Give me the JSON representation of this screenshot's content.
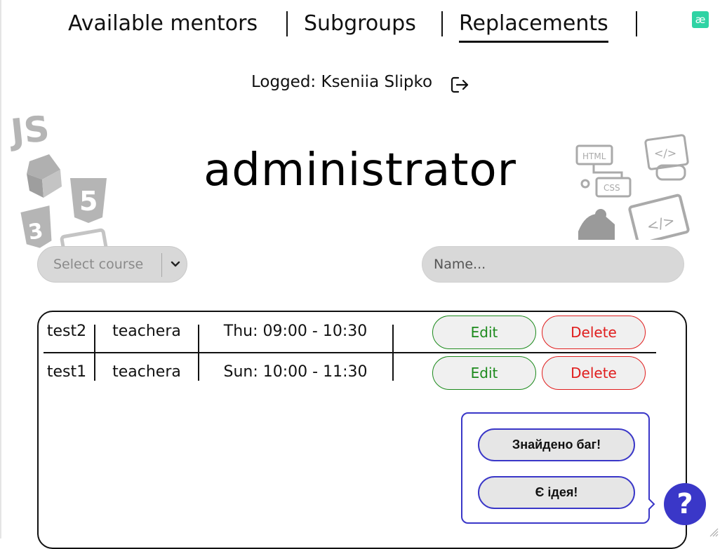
{
  "nav": {
    "items": [
      {
        "label": "Available mentors"
      },
      {
        "label": "Subgroups"
      },
      {
        "label": "Replacements",
        "active": true
      }
    ]
  },
  "extension_icon": {
    "label": "æ",
    "color": "#2fd3a4"
  },
  "user": {
    "logged_text": "Logged: Kseniia Slipko",
    "logout_icon": "logout-icon"
  },
  "page": {
    "title": "administrator"
  },
  "filters": {
    "course_select": {
      "placeholder": "Select course",
      "icon": "chevron-down-icon"
    },
    "name_input": {
      "placeholder": "Name..."
    }
  },
  "table": {
    "rows": [
      {
        "name": "test2",
        "teacher": "teachera",
        "time": "Thu: 09:00 - 10:30",
        "edit": "Edit",
        "delete": "Delete"
      },
      {
        "name": "test1",
        "teacher": "teachera",
        "time": "Sun: 10:00 - 11:30",
        "edit": "Edit",
        "delete": "Delete"
      }
    ]
  },
  "feedback": {
    "bug_label": "Знайдено баг!",
    "idea_label": "Є ідея!",
    "help_label": "?",
    "accent_color": "#3a37c8"
  },
  "colors": {
    "edit": "#1c8a1c",
    "delete": "#e01d1d",
    "input_bg": "#d8d8d8"
  }
}
